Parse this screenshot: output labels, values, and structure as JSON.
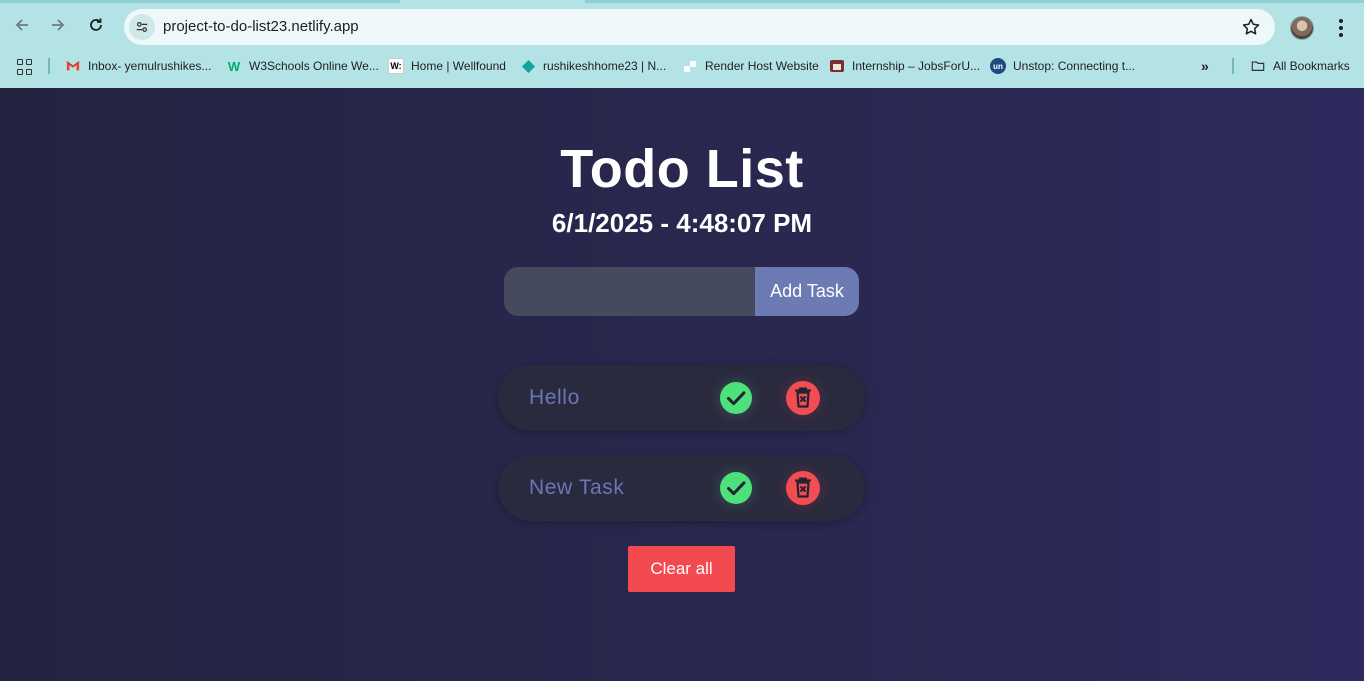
{
  "browser": {
    "url": "project-to-do-list23.netlify.app",
    "bookmarks": [
      {
        "label": "Inbox- yemulrushikes...",
        "icon": "gmail-icon"
      },
      {
        "label": "W3Schools Online We...",
        "icon": "w3schools-icon"
      },
      {
        "label": "Home | Wellfound",
        "icon": "wellfound-icon"
      },
      {
        "label": "rushikeshhome23 | N...",
        "icon": "netlify-icon"
      },
      {
        "label": "Render Host Website",
        "icon": "render-icon"
      },
      {
        "label": "Internship – JobsForU...",
        "icon": "jobsforu-icon"
      },
      {
        "label": "Unstop: Connecting t...",
        "icon": "unstop-icon"
      }
    ],
    "all_bookmarks_label": "All Bookmarks"
  },
  "app": {
    "title": "Todo List",
    "datetime": "6/1/2025 - 4:48:07 PM",
    "input_value": "",
    "add_button_label": "Add Task",
    "tasks": [
      {
        "label": "Hello"
      },
      {
        "label": "New Task"
      }
    ],
    "clear_button_label": "Clear all"
  },
  "colors": {
    "background": "#2b2853",
    "accent": "#6d7bb5",
    "complete": "#4ee07a",
    "delete": "#f34c53"
  }
}
